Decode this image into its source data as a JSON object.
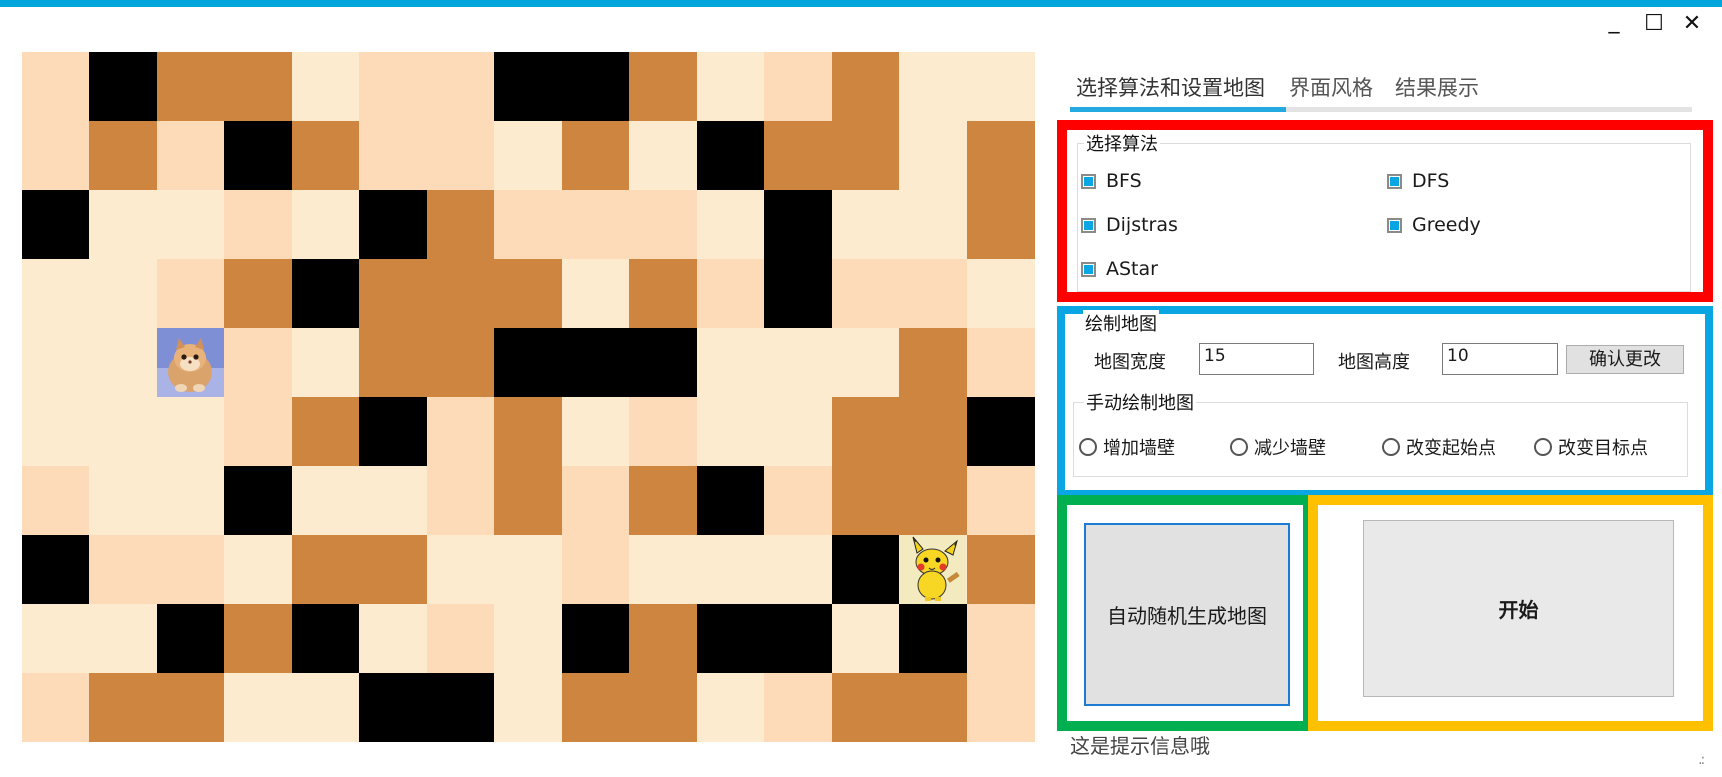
{
  "window": {
    "minimize_glyph": "_",
    "maximize_glyph": "☐",
    "close_glyph": "✕"
  },
  "maze": {
    "cols": 15,
    "rows": 10,
    "palette": {
      "L": "#fdebd0",
      "P": "#fddbb8",
      "B": "#cd853f",
      "K": "#000000"
    },
    "grid": [
      "PKBBLPPKKBLPBLL",
      "PBPKBPPLBLKBBLB",
      "KLLPLKBPPPLKLLB",
      "LLPBKBBBLBPKPPL",
      "LLLPLBBKKKLLLBP",
      "LLLPBKPBLPLLBBK",
      "PLLKLLPBPBKPBBP",
      "KPPLBBLLPLLLKLB",
      "LLKBKLPLKBKKLKP",
      "PBBLLKKLBBLPBBP"
    ],
    "cat_position": {
      "row": 4,
      "col": 2
    },
    "pikachu_position": {
      "row": 7,
      "col": 13
    }
  },
  "tabs": [
    {
      "label": "选择算法和设置地图",
      "active": true
    },
    {
      "label": "界面风格",
      "active": false
    },
    {
      "label": "结果展示",
      "active": false
    }
  ],
  "algorithms": {
    "title": "选择算法",
    "items": [
      {
        "label": "BFS",
        "checked": true
      },
      {
        "label": "DFS",
        "checked": true
      },
      {
        "label": "Dijstras",
        "checked": true
      },
      {
        "label": "Greedy",
        "checked": true
      },
      {
        "label": "AStar",
        "checked": true
      }
    ]
  },
  "map_settings": {
    "title": "绘制地图",
    "width_label": "地图宽度",
    "width_value": "15",
    "height_label": "地图高度",
    "height_value": "10",
    "confirm_label": "确认更改",
    "manual": {
      "title": "手动绘制地图",
      "options": [
        "增加墙壁",
        "减少墙壁",
        "改变起始点",
        "改变目标点"
      ]
    }
  },
  "actions": {
    "auto_generate_label": "自动随机生成地图",
    "start_label": "开始"
  },
  "status_text": "这是提示信息哦",
  "accent_color": "#0aa6e4"
}
